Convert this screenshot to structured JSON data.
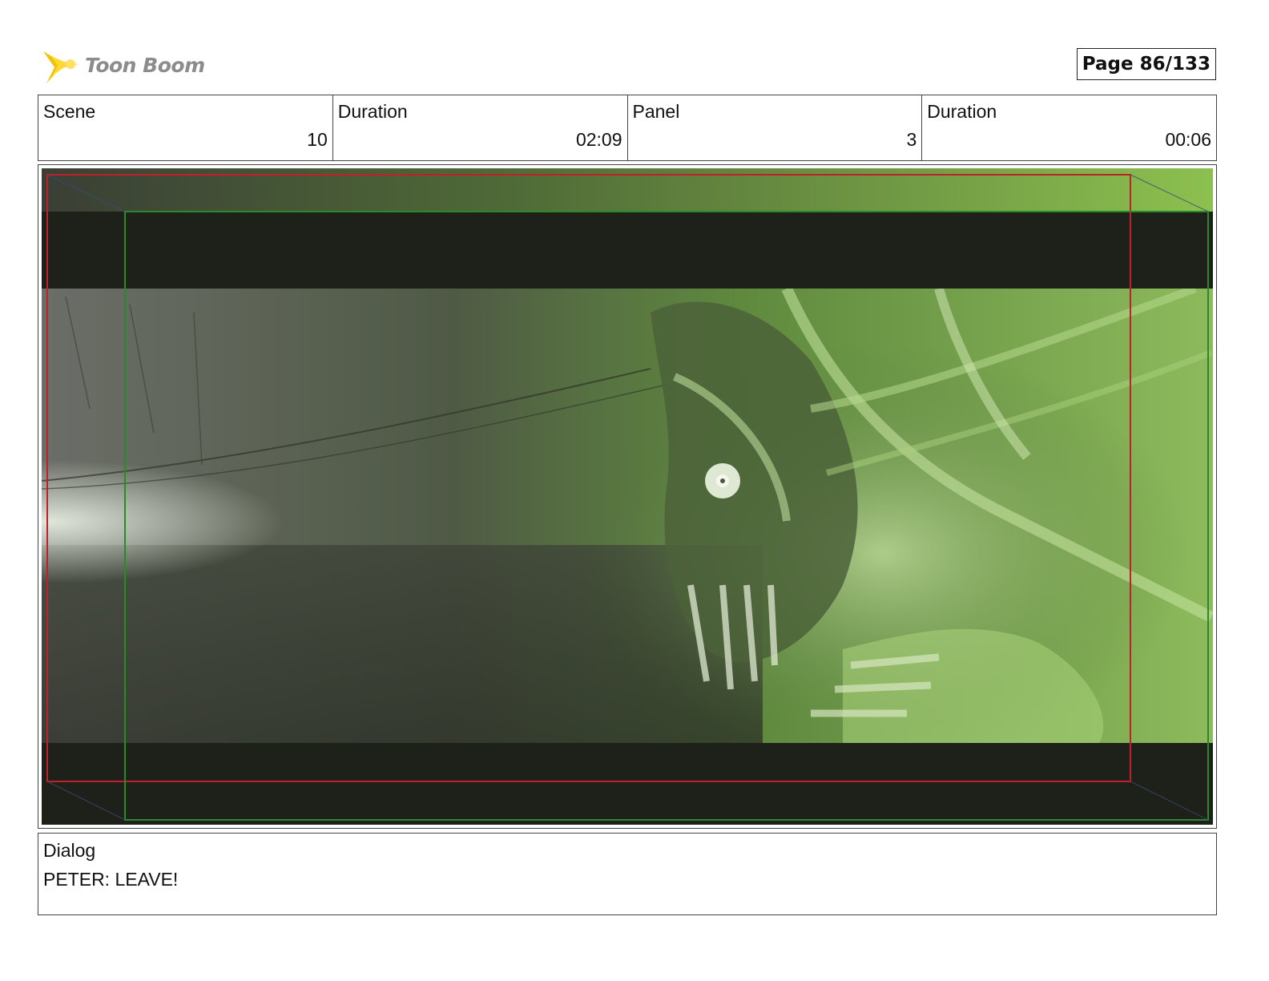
{
  "header": {
    "logo_text": "Toon Boom",
    "page_label": "Page",
    "page_number": "86/133"
  },
  "info": {
    "scene_label": "Scene",
    "scene_value": "10",
    "scene_duration_label": "Duration",
    "scene_duration_value": "02:09",
    "panel_label": "Panel",
    "panel_value": "3",
    "panel_duration_label": "Duration",
    "panel_duration_value": "00:06"
  },
  "panel_image": {
    "accent_green": "#5c9a3c",
    "safe_frame_red": "#c0202a",
    "camera_frame_green": "#2a8a2a",
    "letterbox": "#1e2119"
  },
  "dialog": {
    "label": "Dialog",
    "text": "PETER: LEAVE!"
  }
}
